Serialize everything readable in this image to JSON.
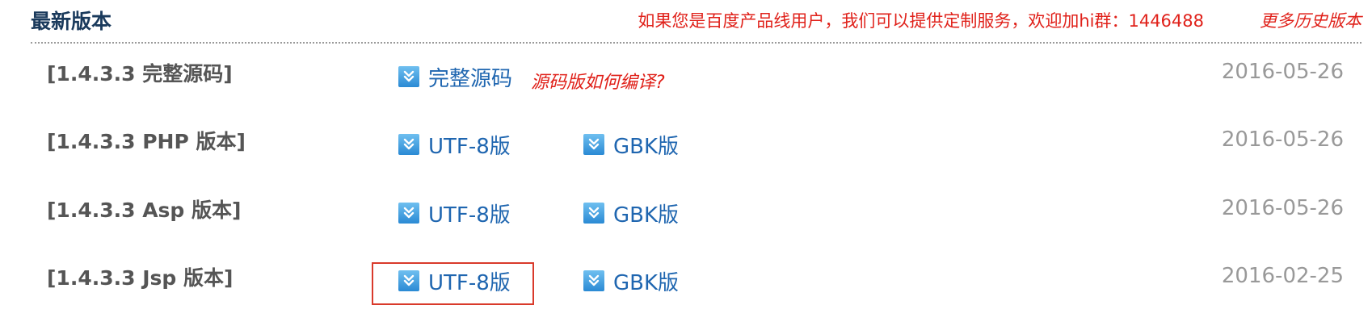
{
  "header": {
    "title": "最新版本",
    "service_note": "如果您是百度产品线用户，我们可以提供定制服务，欢迎加hi群：1446488",
    "more_history": "更多历史版本"
  },
  "rows": [
    {
      "title": "[1.4.3.3 完整源码]",
      "link_label": "完整源码",
      "howto": "源码版如何编译?",
      "date": "2016-05-26"
    },
    {
      "title": "[1.4.3.3 PHP 版本]",
      "utf8_label": "UTF-8版",
      "gbk_label": "GBK版",
      "date": "2016-05-26"
    },
    {
      "title": "[1.4.3.3 Asp 版本]",
      "utf8_label": "UTF-8版",
      "gbk_label": "GBK版",
      "date": "2016-05-26"
    },
    {
      "title": "[1.4.3.3 Jsp 版本]",
      "utf8_label": "UTF-8版",
      "gbk_label": "GBK版",
      "date": "2016-02-25"
    }
  ],
  "icons": {
    "download": "double-chevron-down-icon"
  },
  "colors": {
    "accent_red": "#e0211a",
    "link_blue": "#1f66b0",
    "title_navy": "#1a3a5c",
    "date_gray": "#999999",
    "highlight_border": "#d93a2b"
  }
}
